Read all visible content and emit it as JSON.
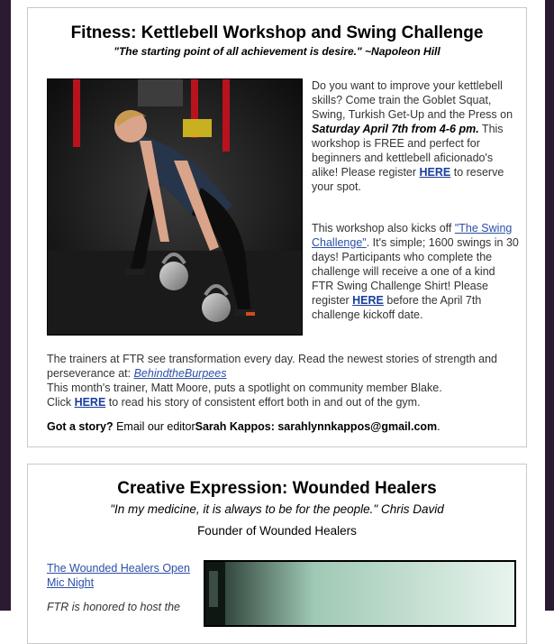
{
  "fitness": {
    "title": "Fitness:  Kettlebell Workshop and Swing Challenge",
    "quote": "\"The starting point of all achievement is desire.\" ~Napoleon Hill",
    "p1_a": "Do you want to improve your kettlebell skills?  Come train the Goblet Squat, Swing, Turkish Get-Up and the Press on ",
    "p1_date": "Saturday April 7th from 4-6 pm.",
    "p1_b": "  This workshop is FREE and perfect for beginners and kettlebell aficionado's alike! Please register ",
    "here1": "HERE",
    "p1_c": " to reserve your spot.",
    "p2_a": "This workshop also kicks off ",
    "swing_link": "\"The Swing Challenge\"",
    "p2_b": ". It's simple; 1600 swings in 30 days! Participants who complete the challenge will receive a one of a kind FTR Swing Challenge Shirt! Please register ",
    "here2": "HERE",
    "p2_c": " before the April 7th challenge kickoff date.",
    "p3_a": "The trainers at FTR see transformation every day.  Read the newest stories of strength and perseverance at: ",
    "burpees_link": "BehindtheBurpees",
    "p3_b": "This month's trainer, Matt Moore, puts a spotlight on community member Blake.",
    "p3_c": "Click ",
    "here3": "HERE",
    "p3_d": " to read his story of consistent effort both in and out of the gym.",
    "story_label": "Got a story?",
    "story_text": " Email our editor",
    "editor_name": "Sarah Kappos",
    "editor_email": ": sarahlynnkappos@gmail.com",
    "story_end": "."
  },
  "creative": {
    "title": "Creative Expression:  Wounded Healers",
    "quote": "\"In my medicine, it is always to be for the people.\" Chris David",
    "founder": "Founder of Wounded Healers",
    "openmic_link": "The Wounded Healers Open Mic Night",
    "honored": "FTR is honored to host the"
  }
}
